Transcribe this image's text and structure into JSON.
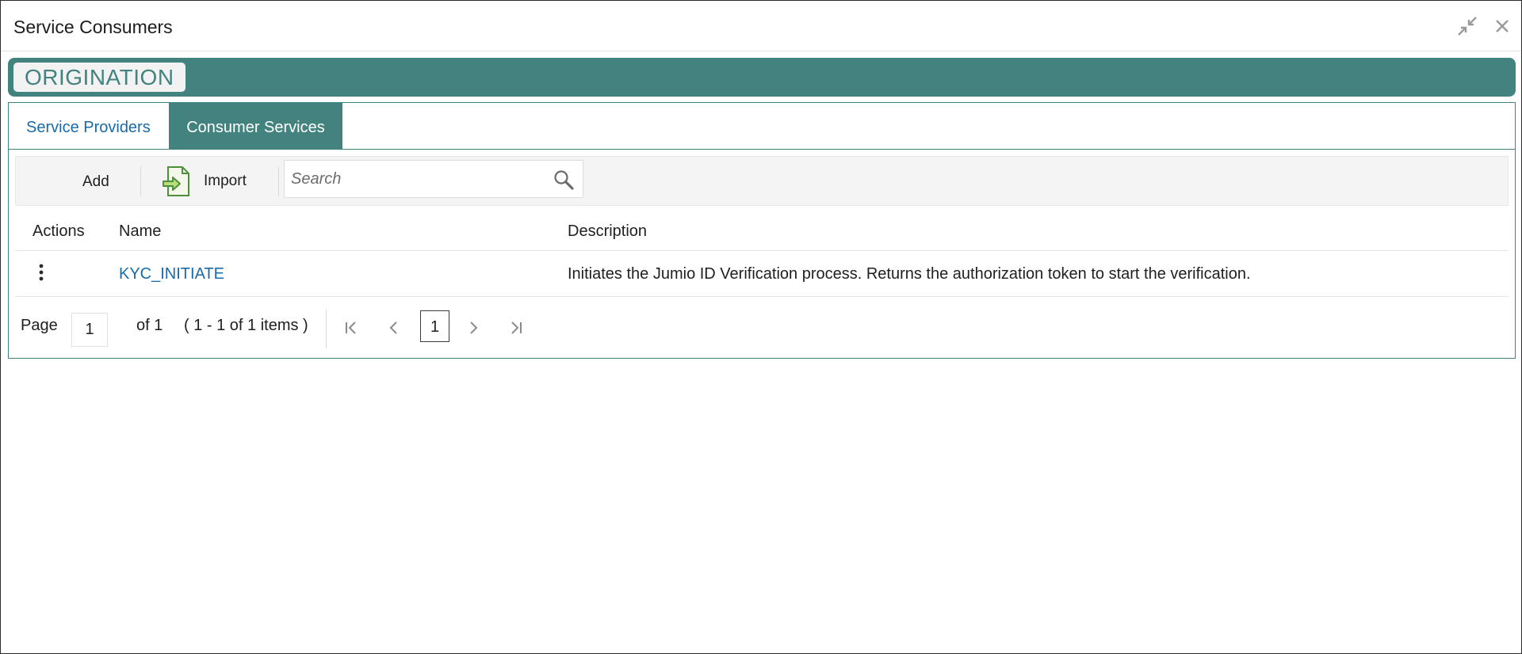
{
  "window": {
    "title": "Service Consumers",
    "minimize_icon": "collapse-arrows-icon",
    "close_icon": "close-icon"
  },
  "banner": {
    "label": "ORIGINATION",
    "color": "#43837f"
  },
  "tabs": [
    {
      "label": "Service Providers",
      "active": false
    },
    {
      "label": "Consumer Services",
      "active": true
    }
  ],
  "toolbar": {
    "add_label": "Add",
    "import_label": "Import",
    "import_icon": "import-document-icon",
    "search_placeholder": "Search",
    "search_icon": "magnifier-icon"
  },
  "table": {
    "headers": {
      "actions": "Actions",
      "name": "Name",
      "description": "Description"
    },
    "rows": [
      {
        "actions_icon": "kebab-menu-icon",
        "name": "KYC_INITIATE",
        "description": "Initiates the Jumio ID Verification process. Returns the authorization token to start the verification."
      }
    ]
  },
  "pager": {
    "page_label": "Page",
    "page_value": "1",
    "of_label": "of 1",
    "items_label": "( 1 - 1 of 1 items )",
    "current_page": "1"
  },
  "colors": {
    "accent": "#43837f",
    "link": "#1b6aa8"
  }
}
